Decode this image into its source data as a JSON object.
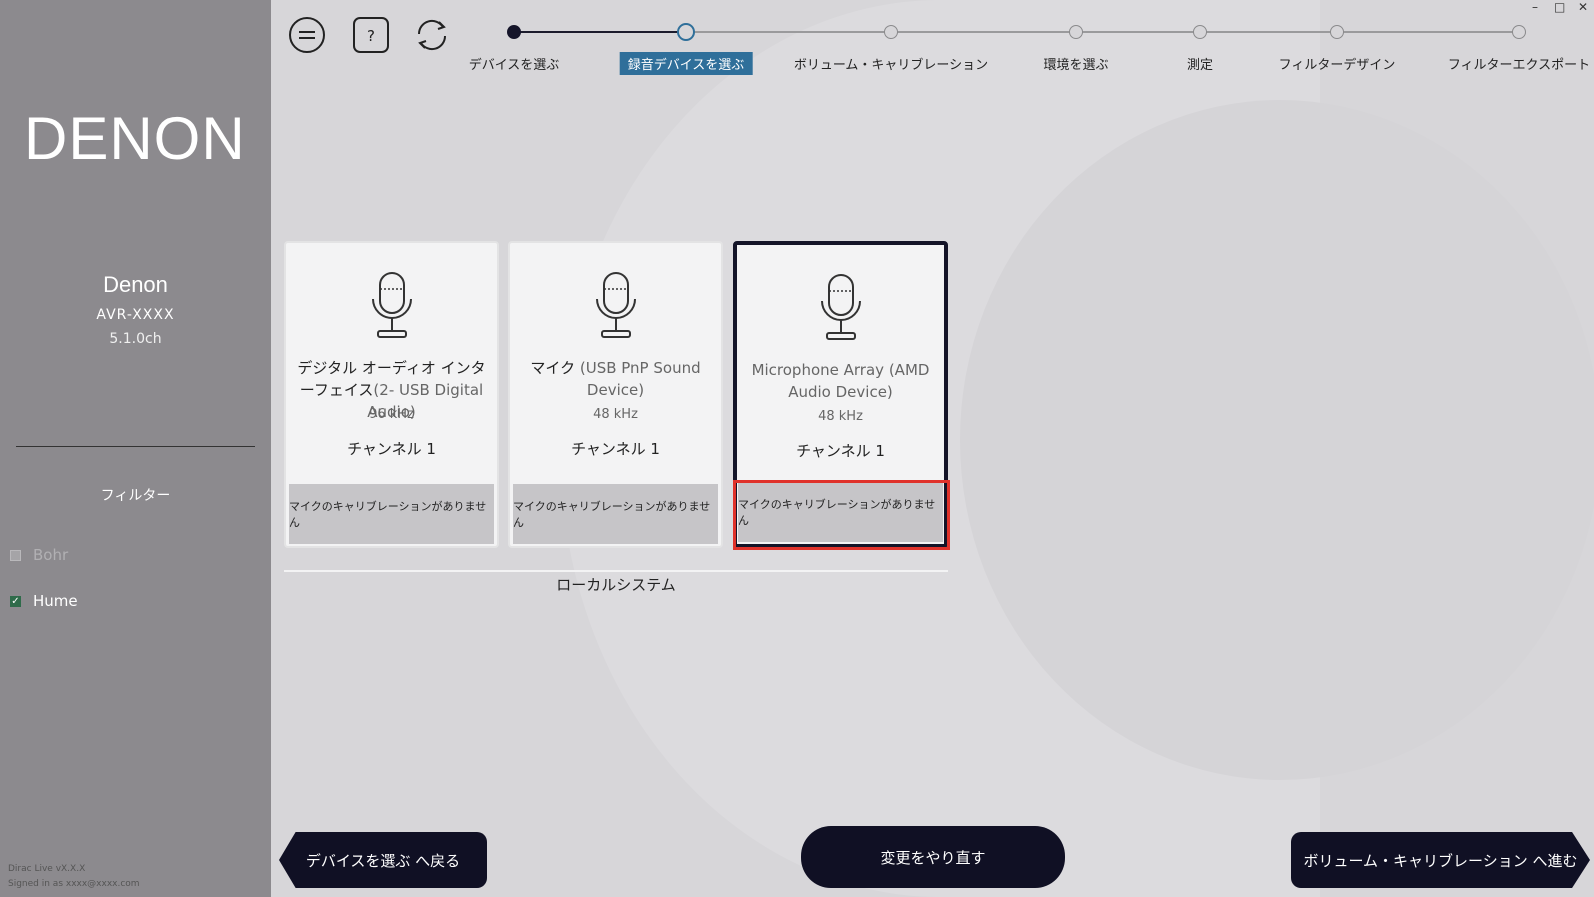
{
  "sidebar": {
    "logo": "DENON",
    "device": {
      "brand": "Denon",
      "model": "AVR-XXXX",
      "channels": "5.1.0ch"
    },
    "filter_title": "フィルター",
    "filters": [
      {
        "label": "Bohr",
        "checked": false
      },
      {
        "label": "Hume",
        "checked": true
      }
    ],
    "version": "Dirac Live vX.X.X",
    "signed_in": "Signed in as xxxx@xxxx.com"
  },
  "window_controls": {
    "minimize": "–",
    "maximize": "□",
    "close": "✕"
  },
  "toolbar": {
    "menu_icon": "menu-icon",
    "help_icon": "help-icon",
    "refresh_icon": "refresh-icon"
  },
  "steps": [
    {
      "label": "デバイスを選ぶ",
      "state": "done"
    },
    {
      "label": "録音デバイスを選ぶ",
      "state": "current"
    },
    {
      "label": "ボリューム・キャリブレーション",
      "state": "todo"
    },
    {
      "label": "環境を選ぶ",
      "state": "todo"
    },
    {
      "label": "測定",
      "state": "todo"
    },
    {
      "label": "フィルターデザイン",
      "state": "todo"
    },
    {
      "label": "フィルターエクスポート",
      "state": "todo"
    }
  ],
  "devices": [
    {
      "name": "デジタル オーディオ インターフェイス",
      "sub": "(2- USB Digital Audio)",
      "rate": "96 kHz",
      "channel": "チャンネル 1",
      "calibration": "マイクのキャリブレーションがありません",
      "selected": false
    },
    {
      "name": "マイク",
      "sub": "(USB PnP Sound Device)",
      "rate": "48 kHz",
      "channel": "チャンネル 1",
      "calibration": "マイクのキャリブレーションがありません",
      "selected": false
    },
    {
      "name": "Microphone Array",
      "sub": "(AMD Audio Device)",
      "rate": "48 kHz",
      "channel": "チャンネル 1",
      "calibration": "マイクのキャリブレーションがありません",
      "selected": true
    }
  ],
  "group_label": "ローカルシステム",
  "buttons": {
    "back": "デバイスを選ぶ へ戻る",
    "reset": "変更をやり直す",
    "next": "ボリューム・キャリブレーション へ進む"
  },
  "colors": {
    "accent": "#2f6f9a",
    "dark": "#101024",
    "highlight": "#e0322b"
  }
}
